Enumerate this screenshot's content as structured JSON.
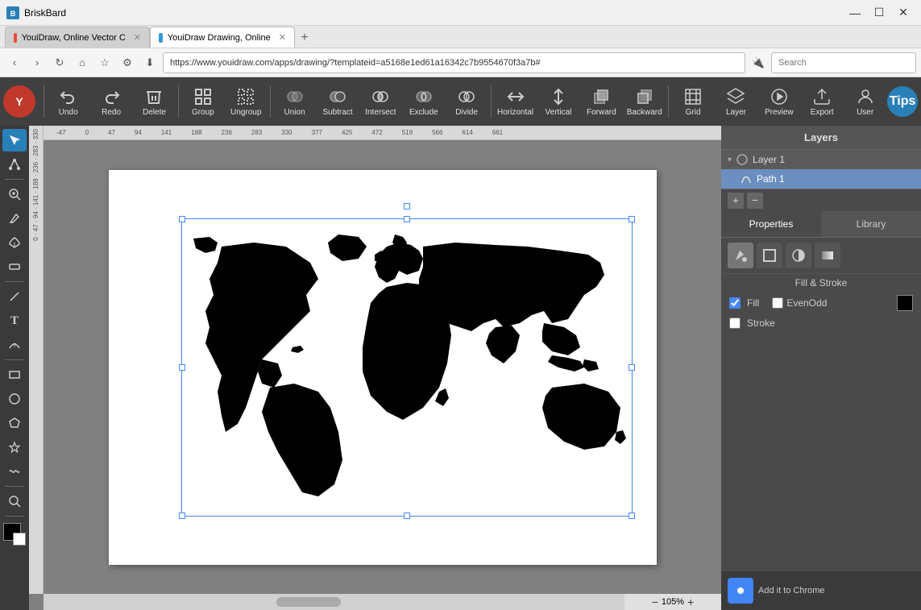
{
  "titlebar": {
    "title": "BriskBard",
    "controls": {
      "minimize": "—",
      "maximize": "☐",
      "close": "✕"
    }
  },
  "browser": {
    "nav": {
      "back": "‹",
      "forward": "›",
      "refresh": "↻",
      "home": "⌂",
      "bookmarks": "☆",
      "settings": "⚙",
      "download": "⬇"
    },
    "url": "https://www.youidraw.com/apps/drawing/?templateid=a5168e1ed61a16342c7b9554670f3a7b#",
    "search_placeholder": "Search",
    "tabs": [
      {
        "label": "YouiDraw, Online Vector C",
        "active": false
      },
      {
        "label": "YouiDraw Drawing, Online",
        "active": true
      }
    ]
  },
  "toolbar": {
    "buttons": [
      {
        "id": "undo",
        "label": "Undo",
        "icon": "↩"
      },
      {
        "id": "redo",
        "label": "Redo",
        "icon": "↪"
      },
      {
        "id": "delete",
        "label": "Delete",
        "icon": "✕"
      },
      {
        "id": "group",
        "label": "Group",
        "icon": "▣"
      },
      {
        "id": "ungroup",
        "label": "Ungroup",
        "icon": "◫"
      },
      {
        "id": "union",
        "label": "Union",
        "icon": "⊕"
      },
      {
        "id": "subtract",
        "label": "Subtract",
        "icon": "⊖"
      },
      {
        "id": "intersect",
        "label": "Intersect",
        "icon": "⊗"
      },
      {
        "id": "exclude",
        "label": "Exclude",
        "icon": "⊘"
      },
      {
        "id": "divide",
        "label": "Divide",
        "icon": "⊙"
      },
      {
        "id": "horizontal",
        "label": "Horizontal",
        "icon": "⇔"
      },
      {
        "id": "vertical",
        "label": "Vertical",
        "icon": "⇕"
      },
      {
        "id": "forward",
        "label": "Forward",
        "icon": "▲"
      },
      {
        "id": "backward",
        "label": "Backward",
        "icon": "▼"
      },
      {
        "id": "grid",
        "label": "Grid",
        "icon": "⊞"
      },
      {
        "id": "layer",
        "label": "Layer",
        "icon": "◧"
      },
      {
        "id": "preview",
        "label": "Preview",
        "icon": "▷"
      },
      {
        "id": "export",
        "label": "Export",
        "icon": "↗"
      },
      {
        "id": "user",
        "label": "User",
        "icon": "👤"
      },
      {
        "id": "tips",
        "label": "Tips",
        "icon": "?"
      }
    ]
  },
  "left_tools": [
    {
      "id": "select",
      "icon": "↖",
      "active": true
    },
    {
      "id": "node",
      "icon": "⬡"
    },
    {
      "id": "zoom-tool",
      "icon": "⊕"
    },
    {
      "id": "pencil",
      "icon": "✏"
    },
    {
      "id": "pen",
      "icon": "✒"
    },
    {
      "id": "eraser",
      "icon": "◻"
    },
    {
      "id": "line",
      "icon": "╱"
    },
    {
      "id": "text",
      "icon": "T"
    },
    {
      "id": "text-on-path",
      "icon": "ℹ"
    },
    {
      "id": "rect",
      "icon": "□"
    },
    {
      "id": "circle",
      "icon": "○"
    },
    {
      "id": "polygon",
      "icon": "⬡"
    },
    {
      "id": "star",
      "icon": "★"
    },
    {
      "id": "freehand",
      "icon": "〜"
    },
    {
      "id": "zoom",
      "icon": "🔍"
    },
    {
      "id": "swatch1",
      "icon": "■"
    },
    {
      "id": "swatch2",
      "icon": "□"
    }
  ],
  "canvas": {
    "zoom_level": "105%",
    "zoom_minus": "−",
    "zoom_plus": "+",
    "ruler_labels": [
      "-47",
      "-0",
      "47",
      "94",
      "141",
      "188",
      "236",
      "283",
      "330",
      "377",
      "425",
      "472",
      "519",
      "566",
      "614",
      "661"
    ]
  },
  "layers_panel": {
    "title": "Layers",
    "layer1": "Layer 1",
    "path1": "Path 1",
    "controls": {
      "add": "+",
      "remove": "−"
    }
  },
  "properties_panel": {
    "tabs": [
      {
        "id": "properties",
        "label": "Properties",
        "active": true
      },
      {
        "id": "library",
        "label": "Library",
        "active": false
      }
    ],
    "icon_buttons": [
      {
        "id": "fill-icon",
        "icon": "▣"
      },
      {
        "id": "stroke-icon",
        "icon": "◻"
      },
      {
        "id": "opacity-icon",
        "icon": "◑"
      },
      {
        "id": "gradient-icon",
        "icon": "▤"
      }
    ],
    "fill_stroke_label": "Fill & Stroke",
    "fill": {
      "checked": true,
      "label": "Fill",
      "even_odd_checked": false,
      "even_odd_label": "EvenOdd",
      "color": "#000000"
    },
    "stroke": {
      "checked": false,
      "label": "Stroke"
    }
  },
  "status_bar": {
    "add_to_chrome": "Add it to Chrome"
  }
}
